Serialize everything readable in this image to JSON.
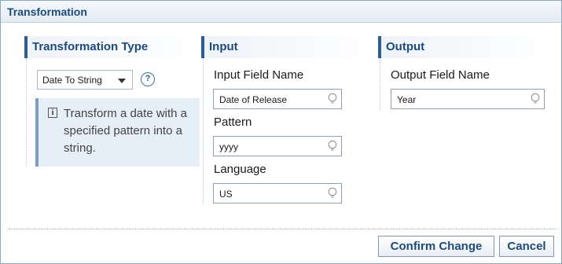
{
  "dialog": {
    "title": "Transformation"
  },
  "columns": {
    "type": {
      "header": "Transformation Type"
    },
    "input": {
      "header": "Input"
    },
    "output": {
      "header": "Output"
    }
  },
  "transformation": {
    "selected": "Date To String",
    "help_label": "?",
    "info_text": "Transform a date with a specified pattern into a string."
  },
  "input_fields": [
    {
      "label": "Input Field Name",
      "value": "Date of Release"
    },
    {
      "label": "Pattern",
      "value": "yyyy"
    },
    {
      "label": "Language",
      "value": "US"
    }
  ],
  "output_fields": [
    {
      "label": "Output Field Name",
      "value": "Year"
    }
  ],
  "buttons": {
    "confirm": "Confirm Change",
    "cancel": "Cancel"
  },
  "icons": {
    "help": "help-icon",
    "info": "info-icon",
    "hint": "lightbulb-icon",
    "dropdown": "chevron-down-icon"
  },
  "colors": {
    "accent": "#2a5d93",
    "title_text": "#1d4a7a",
    "info_background": "#e6eff8"
  }
}
